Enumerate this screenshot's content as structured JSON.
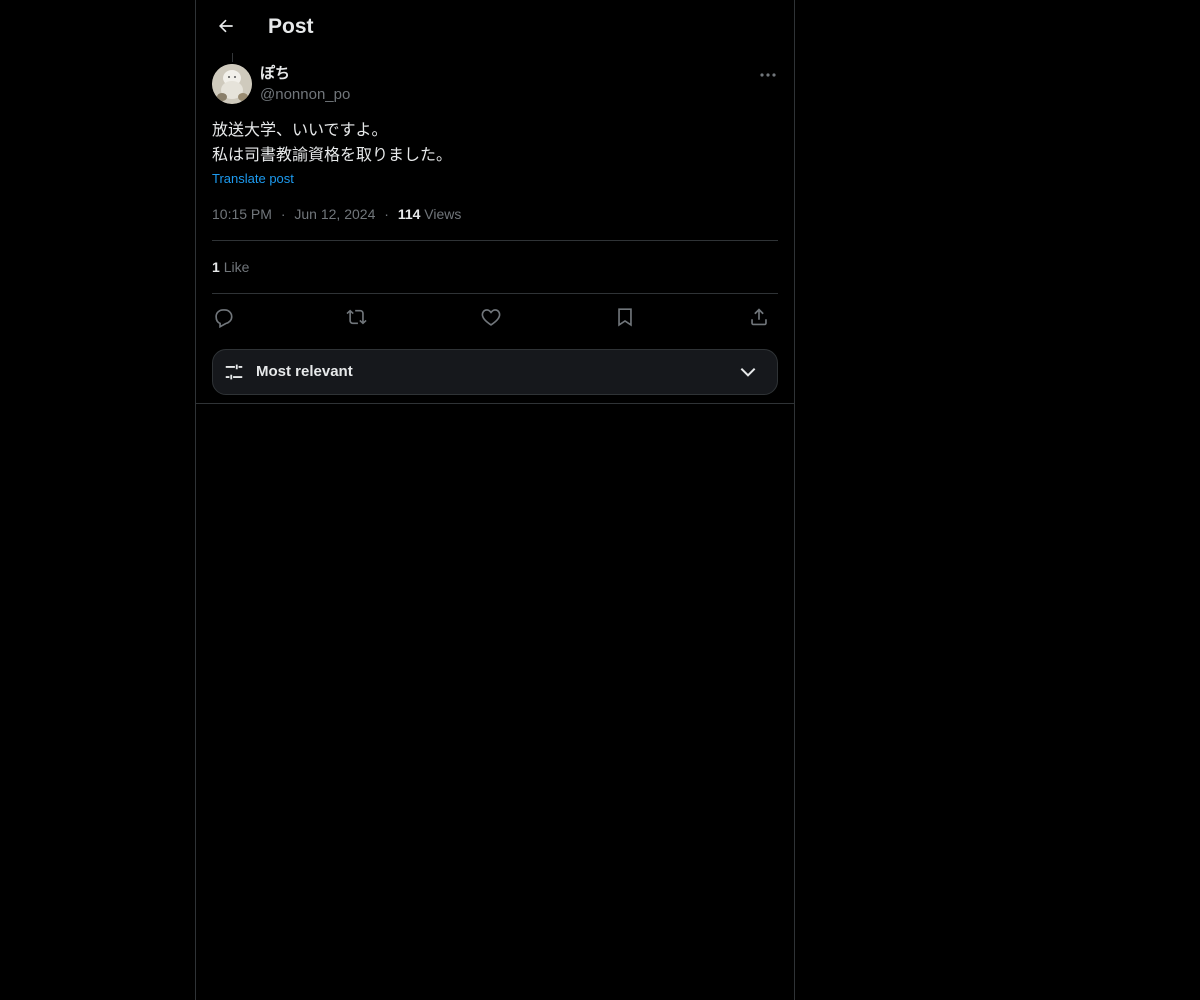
{
  "header": {
    "title": "Post",
    "back_icon": "arrow-left-icon"
  },
  "post": {
    "author_name": "ぽち",
    "author_handle": "@nonnon_po",
    "text_lines": [
      "放送大学、いいですよ。",
      "私は司書教諭資格を取りました。"
    ],
    "translate_label": "Translate post",
    "time": "10:15 PM",
    "separator": "·",
    "date": "Jun 12, 2024",
    "views_count": "114",
    "views_label": "Views",
    "likes_count": "1",
    "likes_label": "Like"
  },
  "actions": {
    "icons": [
      "reply-icon",
      "repost-icon",
      "like-icon",
      "bookmark-icon",
      "share-icon"
    ]
  },
  "sort": {
    "label": "Most relevant",
    "icon": "sliders-icon",
    "chevron": "chevron-down-icon"
  },
  "colors": {
    "background": "#000000",
    "text": "#e7e9ea",
    "secondary": "#71767b",
    "link": "#1d9bf0",
    "border": "#2f3336"
  }
}
